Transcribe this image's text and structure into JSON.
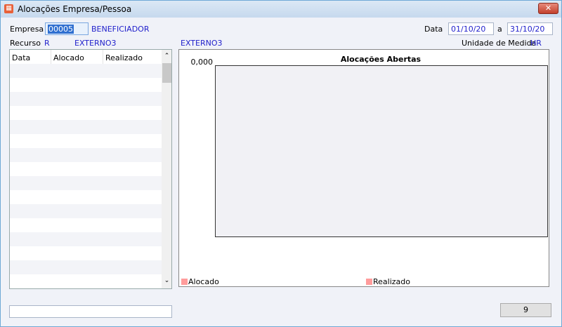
{
  "window": {
    "title": "Alocações Empresa/Pessoa",
    "close_label": "✕"
  },
  "filters": {
    "empresa_label": "Empresa",
    "empresa_code": "00005",
    "empresa_name": "BENEFICIADOR",
    "recurso_label": "Recurso",
    "recurso_code": "R",
    "recurso_name": "EXTERNO3",
    "recurso_name2": "EXTERNO3",
    "data_label": "Data",
    "date_from": "01/10/20",
    "date_sep": "a",
    "date_to": "31/10/20",
    "unidade_label": "Unidade de Medida",
    "unidade_value": "HR"
  },
  "grid": {
    "columns": [
      "Data",
      "Alocado",
      "Realizado"
    ],
    "rows": []
  },
  "chart_data": {
    "type": "bar",
    "title": "Alocações Abertas",
    "y_tick_labels": [
      "0,000"
    ],
    "series": [
      {
        "name": "Alocado",
        "values": [],
        "color": "#ff9c9c"
      },
      {
        "name": "Realizado",
        "values": [],
        "color": "#ff9c9c"
      }
    ],
    "legend": "bottom"
  },
  "footer": {
    "status_value": "",
    "button_label": "9"
  }
}
